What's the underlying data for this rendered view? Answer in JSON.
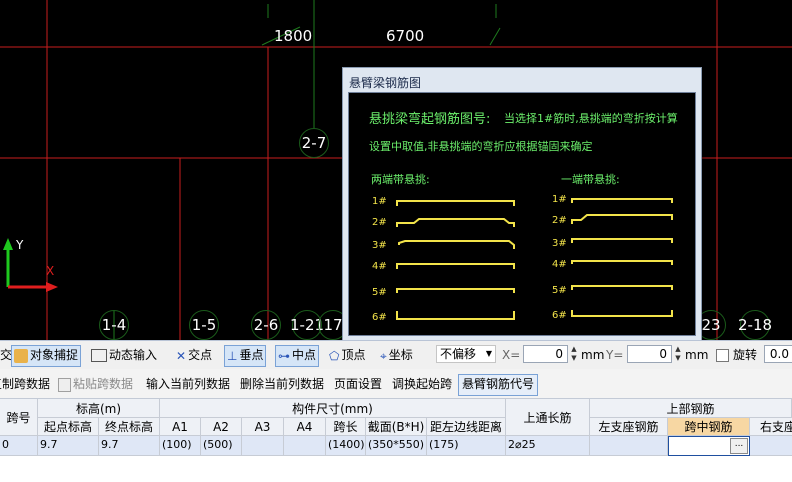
{
  "canvas": {
    "dim_labels": [
      "1800",
      "6700"
    ],
    "axis_bubbles": [
      "2-7",
      "1-4",
      "1-5",
      "2-6",
      "1-21",
      "17",
      "23",
      "2-18"
    ],
    "ucs": {
      "y": "Y",
      "x": "X"
    }
  },
  "dialog": {
    "title": "悬臂梁钢筋图",
    "heading": "悬挑梁弯起钢筋图号:",
    "note1": "当选择1#筋时,悬挑端的弯折按计算",
    "note2": "设置中取值,非悬挑端的弯折应根据锚固来确定",
    "left_caption": "两端带悬挑:",
    "right_caption": "一端带悬挑:",
    "left_numbers": [
      "1#",
      "2#",
      "3#",
      "4#",
      "5#",
      "6#"
    ],
    "right_numbers": [
      "1#",
      "2#",
      "3#",
      "4#",
      "5#",
      "6#"
    ]
  },
  "toolbar": {
    "cut_label": "交",
    "snap_label": "对象捕捉",
    "dynamic_input_label": "动态输入",
    "intersection_label": "交点",
    "perpendicular_label": "垂点",
    "midpoint_label": "中点",
    "vertex_label": "顶点",
    "coordinate_label": "坐标",
    "offset_select": "不偏移",
    "x_label": "X=",
    "x_value": "0",
    "unit1": "mm",
    "y_label": "Y=",
    "y_value": "0",
    "unit2": "mm",
    "rotate_label": "旋转",
    "rotate_value": "0.0"
  },
  "toolbar2": {
    "copy_span": "复制跨数据",
    "paste_span": "粘贴跨数据",
    "input_column": "输入当前列数据",
    "delete_column": "删除当前列数据",
    "page_setup": "页面设置",
    "swap_start": "调换起始跨",
    "cantilever_code": "悬臂钢筋代号"
  },
  "table": {
    "headers": {
      "span": "跨号",
      "elevation": "标高(m)",
      "start_elev": "起点标高",
      "end_elev": "终点标高",
      "member_size": "构件尺寸(mm)",
      "a1": "A1",
      "a2": "A2",
      "a3": "A3",
      "a4": "A4",
      "span_len": "跨长",
      "section": "截面(B*H)",
      "edge_dist": "距左边线距离",
      "top_through": "上通长筋",
      "top_rebar": "上部钢筋",
      "left_support": "左支座钢筋",
      "mid_span": "跨中钢筋",
      "right_support": "右支座钢筋"
    },
    "row": {
      "span": "0",
      "start_elev": "9.7",
      "end_elev": "9.7",
      "a1": "(100)",
      "a2": "(500)",
      "a3": "",
      "a4": "",
      "span_len": "(1400)",
      "section": "(350*550)",
      "edge_dist": "(175)",
      "top_through": "2⌀25",
      "left_support": "",
      "mid_span": "",
      "right_support": "",
      "ellipsis": "..."
    }
  },
  "colors": {
    "canvas_bg": "#000000",
    "grid_red": "#c81e1e",
    "axis_green": "#1e7a1e",
    "rebar_yellow": "#f2e34a",
    "dialog_text_green": "#6cf06c",
    "highlight_header": "#f7d7a3"
  }
}
